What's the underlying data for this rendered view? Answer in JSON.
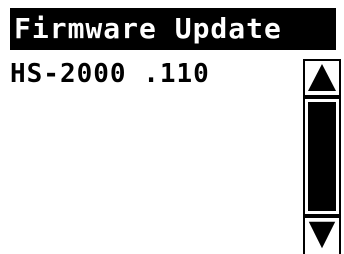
{
  "header": {
    "title": "Firmware Update"
  },
  "list": {
    "items": [
      {
        "label": "HS-2000 .110"
      }
    ]
  },
  "scrollbar": {
    "up_icon": "triangle-up-icon",
    "down_icon": "triangle-down-icon",
    "thumb_fraction": 1.0
  },
  "colors": {
    "foreground": "#000000",
    "background": "#ffffff"
  }
}
